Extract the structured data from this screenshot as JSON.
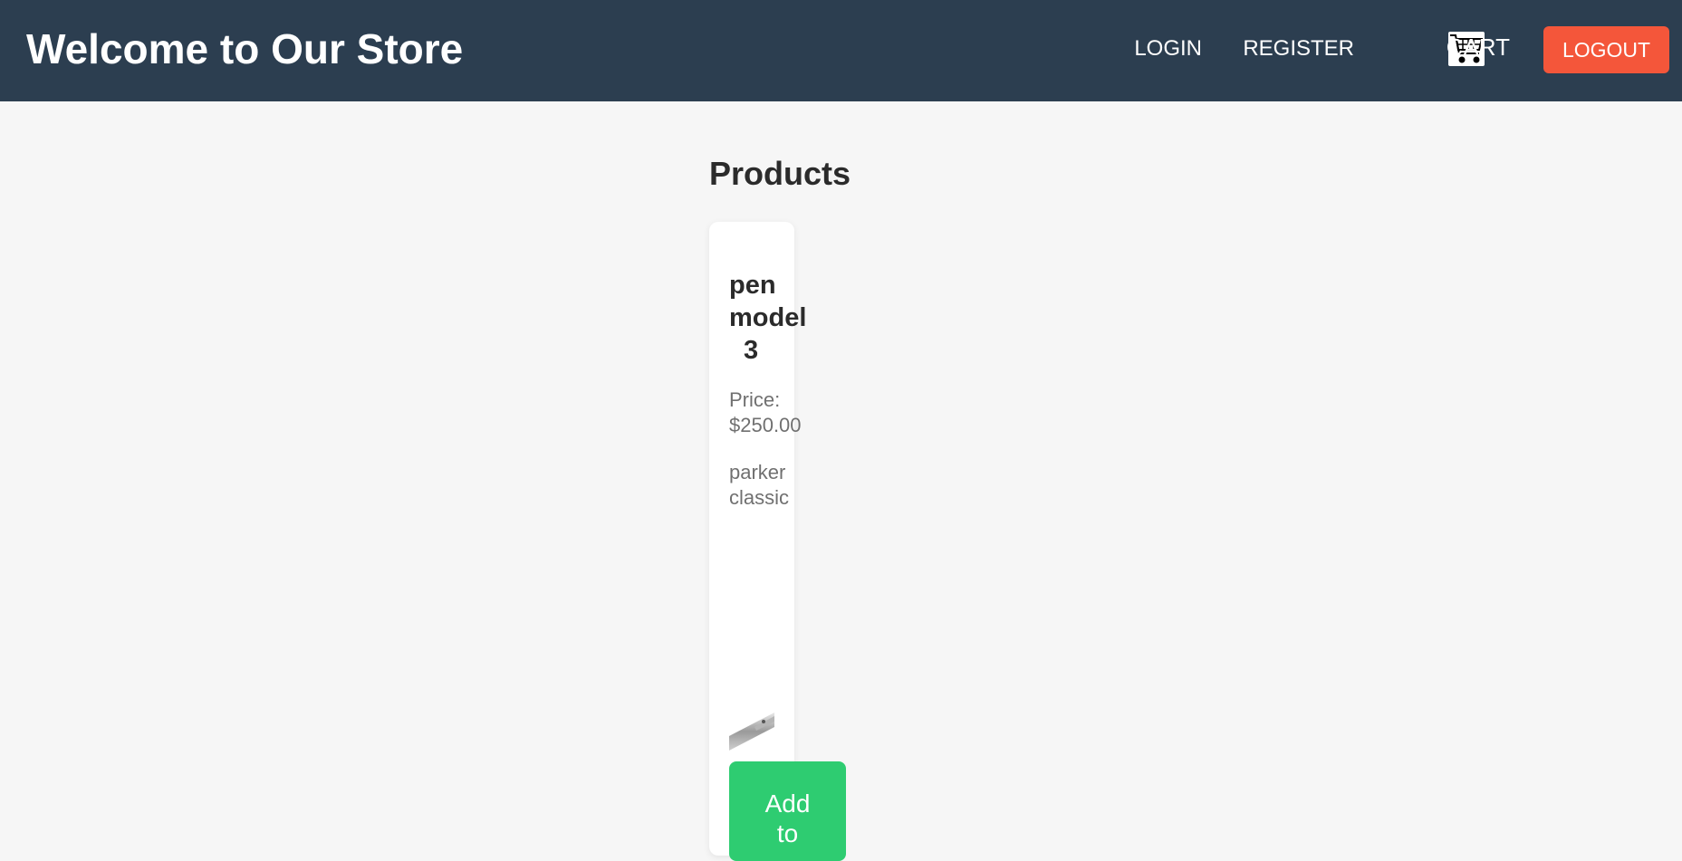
{
  "header": {
    "title": "Welcome to Our Store",
    "nav": {
      "login": "LOGIN",
      "register": "REGISTER",
      "cart": "CART",
      "cart_icon": "cart-icon",
      "logout": "LOGOUT"
    }
  },
  "main": {
    "heading": "Products",
    "products": [
      {
        "name_line1": "pen",
        "name_line2": "model",
        "name_line3": "3",
        "price_label": "Price:",
        "price_value": "$250.00",
        "desc_line1": "parker",
        "desc_line2": "classic",
        "add_line1": "Add",
        "add_line2": "to"
      }
    ]
  },
  "colors": {
    "header_bg": "#2c3e50",
    "logout_bg": "#f4563a",
    "add_bg": "#2ecc71",
    "page_bg": "#f6f6f6"
  }
}
